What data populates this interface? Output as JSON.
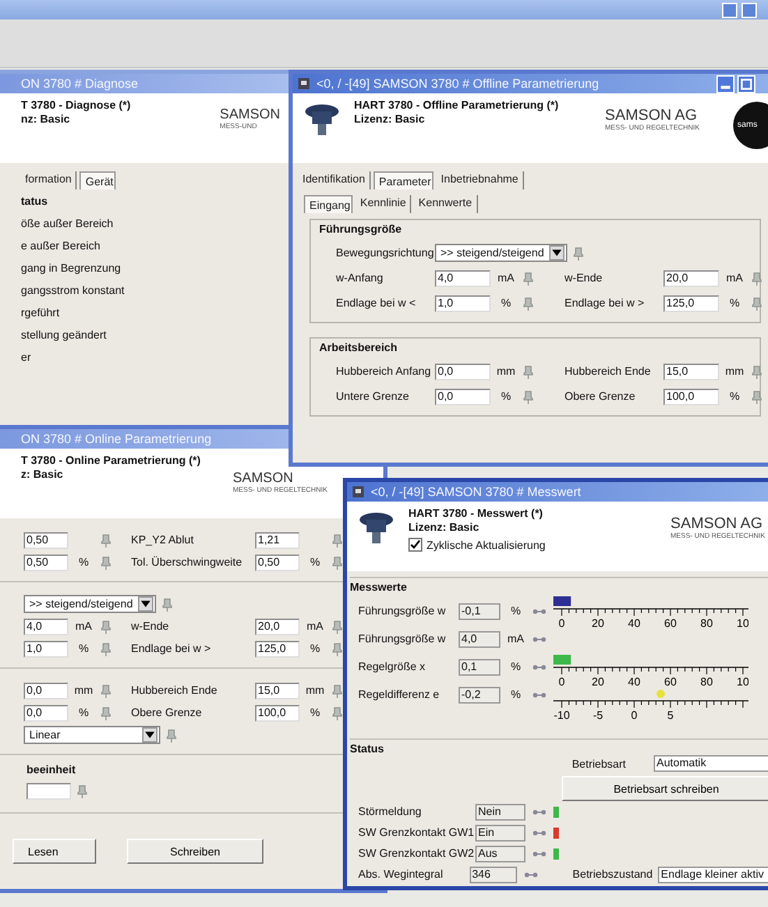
{
  "diagnose": {
    "title": "ON 3780 # Diagnose",
    "heading": "T 3780 - Diagnose (*)",
    "license": "nz:  Basic",
    "brand": "SAMSON",
    "brand_sub": "MESS-UND",
    "tabs": [
      {
        "label": "formation",
        "selected": false
      },
      {
        "label": "Gerät",
        "selected": true
      }
    ],
    "status_title": "tatus",
    "status_items": [
      "öße außer Bereich",
      "e außer Bereich",
      "gang in Begrenzung",
      "gangsstrom konstant",
      "rgeführt",
      "stellung geändert",
      "er"
    ]
  },
  "offline": {
    "title": "<0, / -[49] SAMSON 3780 # Offline Parametrierung",
    "heading": "HART 3780 - Offline Parametrierung (*)",
    "license": "Lizenz:  Basic",
    "brand": "SAMSON AG",
    "brand_sub": "MESS- UND REGELTECHNIK",
    "logo_text": "sams",
    "tabs": [
      {
        "label": "Identifikation",
        "selected": false
      },
      {
        "label": "Parameter",
        "selected": true
      },
      {
        "label": "Inbetriebnahme",
        "selected": false
      }
    ],
    "subtabs": [
      {
        "label": "Eingang",
        "selected": true
      },
      {
        "label": "Kennlinie",
        "selected": false
      },
      {
        "label": "Kennwerte",
        "selected": false
      }
    ],
    "groups": [
      {
        "title": "Führungsgröße",
        "rows": [
          [
            {
              "kind": "label",
              "text": "Bewegungsrichtung"
            },
            {
              "kind": "select",
              "value": ">> steigend/steigend"
            }
          ],
          [
            {
              "kind": "label",
              "text": "w-Anfang"
            },
            {
              "kind": "field",
              "value": "4,0",
              "unit": "mA"
            },
            {
              "kind": "label",
              "text": "w-Ende"
            },
            {
              "kind": "field",
              "value": "20,0",
              "unit": "mA"
            }
          ],
          [
            {
              "kind": "label",
              "text": "Endlage bei w <"
            },
            {
              "kind": "field",
              "value": "1,0",
              "unit": "%"
            },
            {
              "kind": "label",
              "text": "Endlage bei w >"
            },
            {
              "kind": "field",
              "value": "125,0",
              "unit": "%"
            }
          ]
        ]
      },
      {
        "title": "Arbeitsbereich",
        "rows": [
          [
            {
              "kind": "label",
              "text": "Hubbereich Anfang"
            },
            {
              "kind": "field",
              "value": "0,0",
              "unit": "mm"
            },
            {
              "kind": "label",
              "text": "Hubbereich Ende"
            },
            {
              "kind": "field",
              "value": "15,0",
              "unit": "mm"
            }
          ],
          [
            {
              "kind": "label",
              "text": "Untere Grenze"
            },
            {
              "kind": "field",
              "value": "0,0",
              "unit": "%"
            },
            {
              "kind": "label",
              "text": "Obere Grenze"
            },
            {
              "kind": "field",
              "value": "100,0",
              "unit": "%"
            }
          ]
        ]
      }
    ]
  },
  "online": {
    "title": "ON 3780 # Online Parametrierung",
    "heading": "T 3780 - Online Parametrierung (*)",
    "license": "z:  Basic",
    "brand": "SAMSON",
    "brand_sub": "MESS- UND REGELTECHNIK",
    "sections": [
      [
        [
          {
            "kind": "field",
            "value": "0,50"
          },
          {
            "kind": "label",
            "text": "KP_Y2 Ablut"
          },
          {
            "kind": "field",
            "value": "1,21"
          }
        ],
        [
          {
            "kind": "field",
            "value": "0,50",
            "unit": "%"
          },
          {
            "kind": "label",
            "text": "Tol. Überschwingweite"
          },
          {
            "kind": "field",
            "value": "0,50",
            "unit": "%"
          }
        ]
      ],
      [
        [
          {
            "kind": "select",
            "value": ">> steigend/steigend"
          }
        ],
        [
          {
            "kind": "field",
            "value": "4,0",
            "unit": "mA"
          },
          {
            "kind": "label",
            "text": "w-Ende"
          },
          {
            "kind": "field",
            "value": "20,0",
            "unit": "mA"
          }
        ],
        [
          {
            "kind": "field",
            "value": "1,0",
            "unit": "%"
          },
          {
            "kind": "label",
            "text": "Endlage bei w >"
          },
          {
            "kind": "field",
            "value": "125,0",
            "unit": "%"
          }
        ]
      ],
      [
        [
          {
            "kind": "field",
            "value": "0,0",
            "unit": "mm"
          },
          {
            "kind": "label",
            "text": "Hubbereich Ende"
          },
          {
            "kind": "field",
            "value": "15,0",
            "unit": "mm"
          }
        ],
        [
          {
            "kind": "field",
            "value": "0,0",
            "unit": "%"
          },
          {
            "kind": "label",
            "text": "Obere Grenze"
          },
          {
            "kind": "field",
            "value": "100,0",
            "unit": "%"
          }
        ],
        [
          {
            "kind": "select_wide",
            "value": "Linear"
          }
        ]
      ]
    ],
    "group_title": "beeinheit",
    "buttons": [
      "Lesen",
      "Schreiben"
    ]
  },
  "messwert": {
    "title": "<0, / -[49] SAMSON 3780 # Messwert",
    "heading": "HART 3780 - Messwert (*)",
    "license": "Lizenz:  Basic",
    "brand": "SAMSON AG",
    "brand_sub": "MESS- UND REGELTECHNIK",
    "cyclic": {
      "label": "Zyklische Aktualisierung",
      "checked": true
    },
    "group_title": "Messwerte",
    "rows": [
      {
        "label": "Führungsgröße w",
        "value": "-0,1",
        "unit": "%"
      },
      {
        "label": "Führungsgröße w",
        "value": "4,0",
        "unit": "mA"
      },
      {
        "label": "Regelgröße x",
        "value": "0,1",
        "unit": "%"
      },
      {
        "label": "Regeldifferenz e",
        "value": "-0,2",
        "unit": "%"
      }
    ],
    "meters": [
      {
        "kind": "bar",
        "color": "#2e2e94",
        "level": 0.09,
        "ticks": [
          "0",
          "20",
          "40",
          "60",
          "80",
          "10"
        ]
      },
      {
        "kind": "bar",
        "color": "#3db84a",
        "level": 0.09,
        "ticks": [
          "0",
          "20",
          "40",
          "60",
          "80",
          "10"
        ]
      },
      {
        "kind": "marker",
        "color": "#e6e23c",
        "level": 0.55,
        "ticks": [
          "-10",
          "-5",
          "0",
          "5"
        ]
      }
    ],
    "status_title": "Status",
    "mode_label": "Betriebsart",
    "mode_value": "Automatik",
    "mode_button": "Betriebsart schreiben",
    "status_rows": [
      {
        "label": "Störmeldung",
        "value": "Nein",
        "color": "#3db84a"
      },
      {
        "label": "SW Grenzkontakt GW1",
        "value": "Ein",
        "color": "#d83a30"
      },
      {
        "label": "SW Grenzkontakt GW2",
        "value": "Aus",
        "color": "#3db84a"
      },
      {
        "label": "Abs. Wegintegral",
        "value": "346"
      }
    ],
    "state_label": "Betriebszustand",
    "state_value": "Endlage kleiner aktiv"
  }
}
